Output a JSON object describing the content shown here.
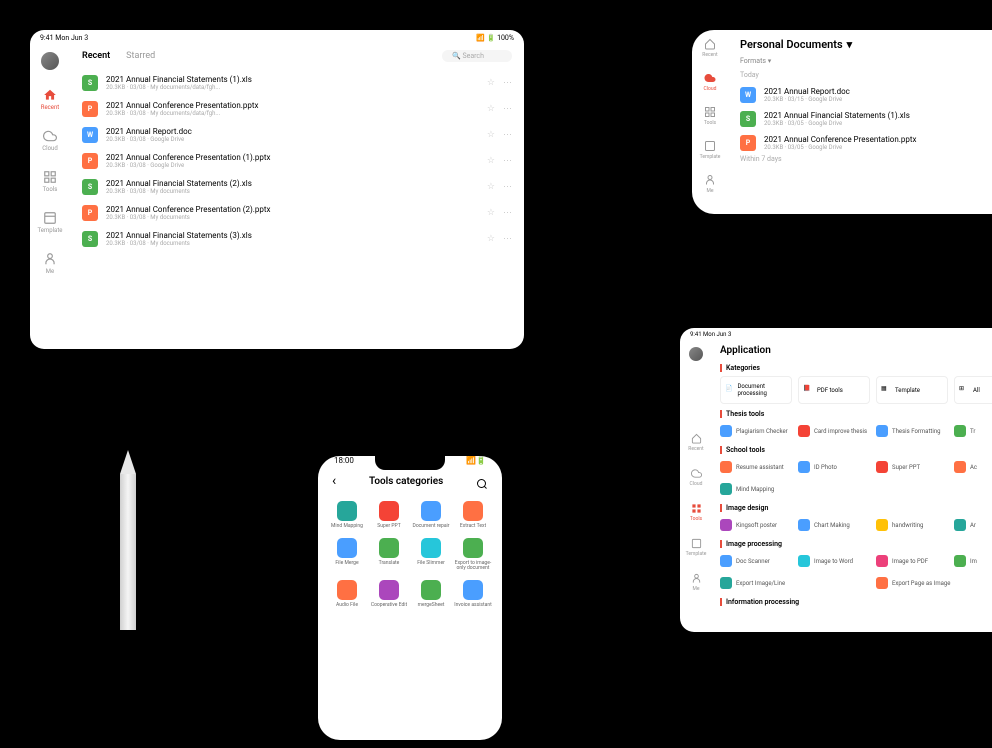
{
  "d1": {
    "status": {
      "time": "9:41 Mon Jun 3",
      "battery": "100%"
    },
    "sidebar": [
      {
        "label": "Recent",
        "active": true
      },
      {
        "label": "Cloud",
        "active": false
      },
      {
        "label": "Tools",
        "active": false
      },
      {
        "label": "Template",
        "active": false
      },
      {
        "label": "Me",
        "active": false
      }
    ],
    "tabs": [
      {
        "label": "Recent",
        "active": true
      },
      {
        "label": "Starred",
        "active": false
      }
    ],
    "search_placeholder": "Search",
    "files": [
      {
        "name": "2021 Annual Financial Statements (1).xls",
        "meta": "20.3KB · 03/08 · My documents/data/fgh...",
        "color": "ic-green",
        "type": "S"
      },
      {
        "name": "2021 Annual Conference Presentation.pptx",
        "meta": "20.3KB · 03/08 · My documents/data/fgh...",
        "color": "ic-orange",
        "type": "P"
      },
      {
        "name": "2021 Annual Report.doc",
        "meta": "20.3KB · 03/08 · Google Drive",
        "color": "ic-blue",
        "type": "W"
      },
      {
        "name": "2021 Annual Conference Presentation (1).pptx",
        "meta": "20.3KB · 03/08 · Google Drive",
        "color": "ic-orange",
        "type": "P"
      },
      {
        "name": "2021 Annual Financial Statements (2).xls",
        "meta": "20.3KB · 03/08 · My documents",
        "color": "ic-green",
        "type": "S"
      },
      {
        "name": "2021 Annual Conference Presentation (2).pptx",
        "meta": "20.3KB · 03/08 · My documents",
        "color": "ic-orange",
        "type": "P"
      },
      {
        "name": "2021 Annual Financial Statements (3).xls",
        "meta": "20.3KB · 03/08 · My documents",
        "color": "ic-green",
        "type": "S"
      }
    ]
  },
  "d2": {
    "sidebar": [
      {
        "label": "Recent",
        "active": false
      },
      {
        "label": "Cloud",
        "active": true
      },
      {
        "label": "Tools",
        "active": false
      },
      {
        "label": "Template",
        "active": false
      },
      {
        "label": "Me",
        "active": false
      }
    ],
    "header": "Personal Documents",
    "filter": "Formats",
    "section_today": "Today",
    "section_week": "Within 7 days",
    "files": [
      {
        "name": "2021 Annual Report.doc",
        "meta": "20.3KB · 03/15 · Google Drive",
        "color": "ic-blue",
        "type": "W"
      },
      {
        "name": "2021 Annual Financial Statements (1).xls",
        "meta": "20.3KB · 03/05 · Google Drive",
        "color": "ic-green",
        "type": "S"
      },
      {
        "name": "2021 Annual Conference Presentation.pptx",
        "meta": "20.3KB · 03/05 · Google Drive",
        "color": "ic-orange",
        "type": "P"
      }
    ]
  },
  "d3": {
    "time": "18:00",
    "title": "Tools categories",
    "tools": [
      {
        "label": "Mind Mapping",
        "color": "ic-teal"
      },
      {
        "label": "Super PPT",
        "color": "ic-red"
      },
      {
        "label": "Document repair",
        "color": "ic-blue"
      },
      {
        "label": "Extract Text",
        "color": "ic-orange"
      },
      {
        "label": "File Merge",
        "color": "ic-blue"
      },
      {
        "label": "Translate",
        "color": "ic-green"
      },
      {
        "label": "File Slimmer",
        "color": "ic-cyan"
      },
      {
        "label": "Export to image-only document",
        "color": "ic-green"
      },
      {
        "label": "Audio File",
        "color": "ic-orange"
      },
      {
        "label": "Cooperative Edit",
        "color": "ic-purple"
      },
      {
        "label": "mergeSheet",
        "color": "ic-green"
      },
      {
        "label": "Invoice assistant",
        "color": "ic-blue"
      }
    ]
  },
  "d4": {
    "status": {
      "time": "9:41 Mon Jun 3"
    },
    "sidebar": [
      {
        "label": "Recent",
        "active": false
      },
      {
        "label": "Cloud",
        "active": false
      },
      {
        "label": "Tools",
        "active": true
      },
      {
        "label": "Template",
        "active": false
      },
      {
        "label": "Me",
        "active": false
      }
    ],
    "page_title": "Application",
    "section_categories": "Kategories",
    "categories": [
      {
        "label": "Document processing"
      },
      {
        "label": "PDF tools"
      },
      {
        "label": "Template"
      },
      {
        "label": "All"
      }
    ],
    "section_thesis": "Thesis tools",
    "thesis_tools": [
      {
        "label": "Plagiarism Checker",
        "color": "ic-blue"
      },
      {
        "label": "Card improve thesis",
        "color": "ic-red"
      },
      {
        "label": "Thesis Formatting",
        "color": "ic-blue"
      },
      {
        "label": "Tr",
        "color": "ic-green"
      }
    ],
    "section_school": "School tools",
    "school_tools": [
      {
        "label": "Resume assistant",
        "color": "ic-orange"
      },
      {
        "label": "ID Photo",
        "color": "ic-blue"
      },
      {
        "label": "Super PPT",
        "color": "ic-red"
      },
      {
        "label": "Ac",
        "color": "ic-orange"
      }
    ],
    "mind_mapping": "Mind Mapping",
    "section_image_design": "Image design",
    "image_design_tools": [
      {
        "label": "Kingsoft poster",
        "color": "ic-purple"
      },
      {
        "label": "Chart Making",
        "color": "ic-blue"
      },
      {
        "label": "handwriting",
        "color": "ic-yellow"
      },
      {
        "label": "Ar",
        "color": "ic-teal"
      }
    ],
    "section_image_processing": "Image processing",
    "image_processing_tools": [
      {
        "label": "Doc Scanner",
        "color": "ic-blue"
      },
      {
        "label": "Image to Word",
        "color": "ic-cyan"
      },
      {
        "label": "Image to PDF",
        "color": "ic-pink"
      },
      {
        "label": "Im",
        "color": "ic-green"
      }
    ],
    "more_tools": [
      {
        "label": "Export Image/Line",
        "color": "ic-teal"
      },
      {
        "label": "Export Page as Image",
        "color": "ic-orange"
      }
    ],
    "section_info": "Information processing"
  }
}
